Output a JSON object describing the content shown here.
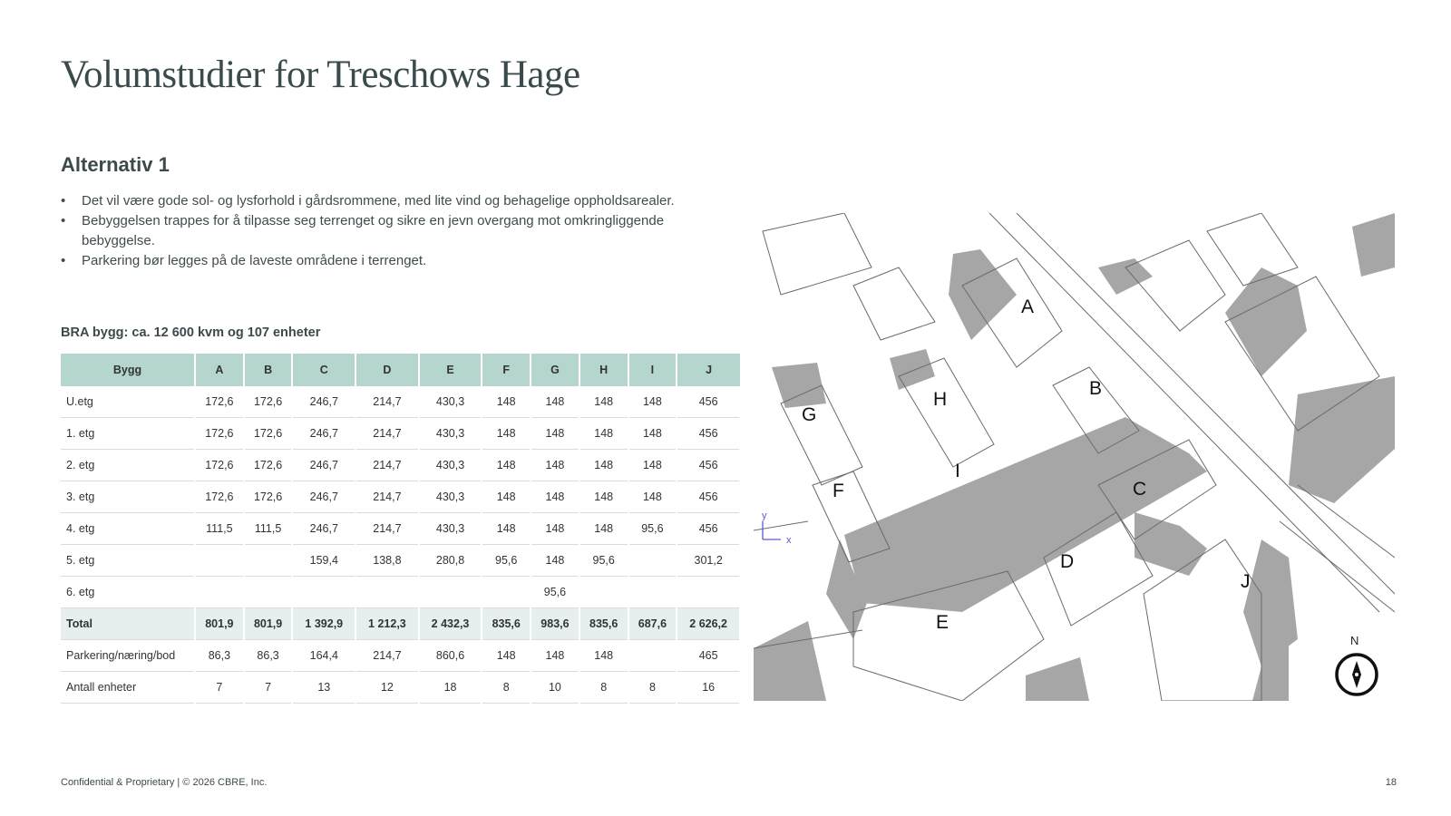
{
  "page": {
    "title": "Volumstudier for Treschows Hage",
    "subtitle": "Alternativ 1",
    "bullets": [
      "Det vil være gode sol- og lysforhold i gårdsrommene, med lite vind og behagelige oppholdsarealer.",
      "Bebyggelsen trappes for å tilpasse seg terrenget og sikre en jevn overgang mot omkringliggende bebyggelse.",
      "Parkering bør legges på de laveste områdene i terrenget."
    ],
    "table_caption": "BRA bygg: ca. 12 600 kvm og 107 enheter",
    "footer": "Confidential & Proprietary | © 2026 CBRE, Inc.",
    "page_number": "18"
  },
  "table": {
    "headers": [
      "Bygg",
      "A",
      "B",
      "C",
      "D",
      "E",
      "F",
      "G",
      "H",
      "I",
      "J"
    ],
    "rows": [
      [
        "U.etg",
        "172,6",
        "172,6",
        "246,7",
        "214,7",
        "430,3",
        "148",
        "148",
        "148",
        "148",
        "456"
      ],
      [
        "1. etg",
        "172,6",
        "172,6",
        "246,7",
        "214,7",
        "430,3",
        "148",
        "148",
        "148",
        "148",
        "456"
      ],
      [
        "2. etg",
        "172,6",
        "172,6",
        "246,7",
        "214,7",
        "430,3",
        "148",
        "148",
        "148",
        "148",
        "456"
      ],
      [
        "3. etg",
        "172,6",
        "172,6",
        "246,7",
        "214,7",
        "430,3",
        "148",
        "148",
        "148",
        "148",
        "456"
      ],
      [
        "4. etg",
        "111,5",
        "111,5",
        "246,7",
        "214,7",
        "430,3",
        "148",
        "148",
        "148",
        "95,6",
        "456"
      ],
      [
        "5. etg",
        "",
        "",
        "159,4",
        "138,8",
        "280,8",
        "95,6",
        "148",
        "95,6",
        "",
        "301,2"
      ],
      [
        "6. etg",
        "",
        "",
        "",
        "",
        "",
        "",
        "95,6",
        "",
        "",
        ""
      ],
      [
        "Total",
        "801,9",
        "801,9",
        "1 392,9",
        "1 212,3",
        "2 432,3",
        "835,6",
        "983,6",
        "835,6",
        "687,6",
        "2 626,2"
      ],
      [
        "Parkering/næring/bod",
        "86,3",
        "86,3",
        "164,4",
        "214,7",
        "860,6",
        "148",
        "148",
        "148",
        "",
        "465"
      ],
      [
        "Antall enheter",
        "7",
        "7",
        "13",
        "12",
        "18",
        "8",
        "10",
        "8",
        "8",
        "16"
      ]
    ]
  },
  "map": {
    "building_labels": [
      "A",
      "B",
      "C",
      "D",
      "E",
      "F",
      "G",
      "H",
      "I",
      "J"
    ],
    "axis_labels": [
      "y",
      "x"
    ],
    "north_label": "N",
    "icons": [
      "compass-icon"
    ],
    "colors": {
      "shadow": "#a6a6a6",
      "lines": "#6a6a6a",
      "header": "#b4d6cf",
      "total_row": "#e6efed"
    }
  }
}
